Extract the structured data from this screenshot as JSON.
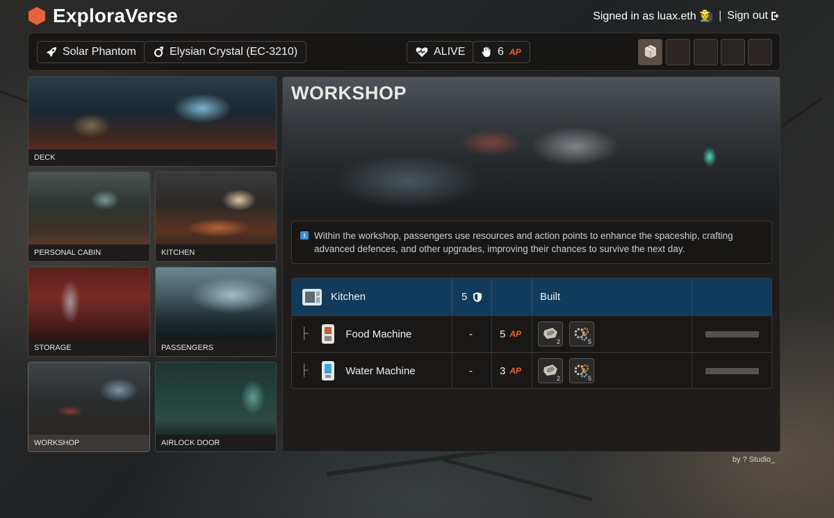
{
  "app": {
    "title": "ExploraVerse"
  },
  "auth": {
    "signed_in_text": "Signed in as luax.eth 🧑‍🌾",
    "separator": "|",
    "sign_out_label": "Sign out"
  },
  "status": {
    "ship_name": "Solar Phantom",
    "planet": "Elysian Crystal (EC-3210)",
    "life_state": "ALIVE",
    "action_points": "6",
    "ap_label": "AP"
  },
  "rooms": [
    {
      "label": "DECK",
      "active": false
    },
    {
      "label": "PERSONAL CABIN",
      "active": false
    },
    {
      "label": "KITCHEN",
      "active": false
    },
    {
      "label": "STORAGE",
      "active": false
    },
    {
      "label": "PASSENGERS",
      "active": false
    },
    {
      "label": "WORKSHOP",
      "active": true
    },
    {
      "label": "AIRLOCK DOOR",
      "active": false
    }
  ],
  "workshop": {
    "title": "WORKSHOP",
    "info": "Within the workshop, passengers use resources and action points to enhance the spaceship, crafting advanced defences, and other upgrades, improving their chances to survive the next day.",
    "table": {
      "header": {
        "name": "Kitchen",
        "defense": "5",
        "status": "Built"
      },
      "rows": [
        {
          "name": "Food Machine",
          "defense": "-",
          "ap": "5",
          "ap_label": "AP",
          "materials": [
            {
              "icon": "scrap-metal-icon",
              "count": "2"
            },
            {
              "icon": "gears-icon",
              "count": "5"
            }
          ],
          "progress": 0
        },
        {
          "name": "Water Machine",
          "defense": "-",
          "ap": "3",
          "ap_label": "AP",
          "materials": [
            {
              "icon": "scrap-metal-icon",
              "count": "2"
            },
            {
              "icon": "gears-icon",
              "count": "5"
            }
          ],
          "progress": 0
        }
      ]
    }
  },
  "footer": {
    "credit": "by ? Studio_"
  },
  "colors": {
    "accent": "#f0642c",
    "header_row": "#123b5b",
    "logo": "#e8623a"
  }
}
